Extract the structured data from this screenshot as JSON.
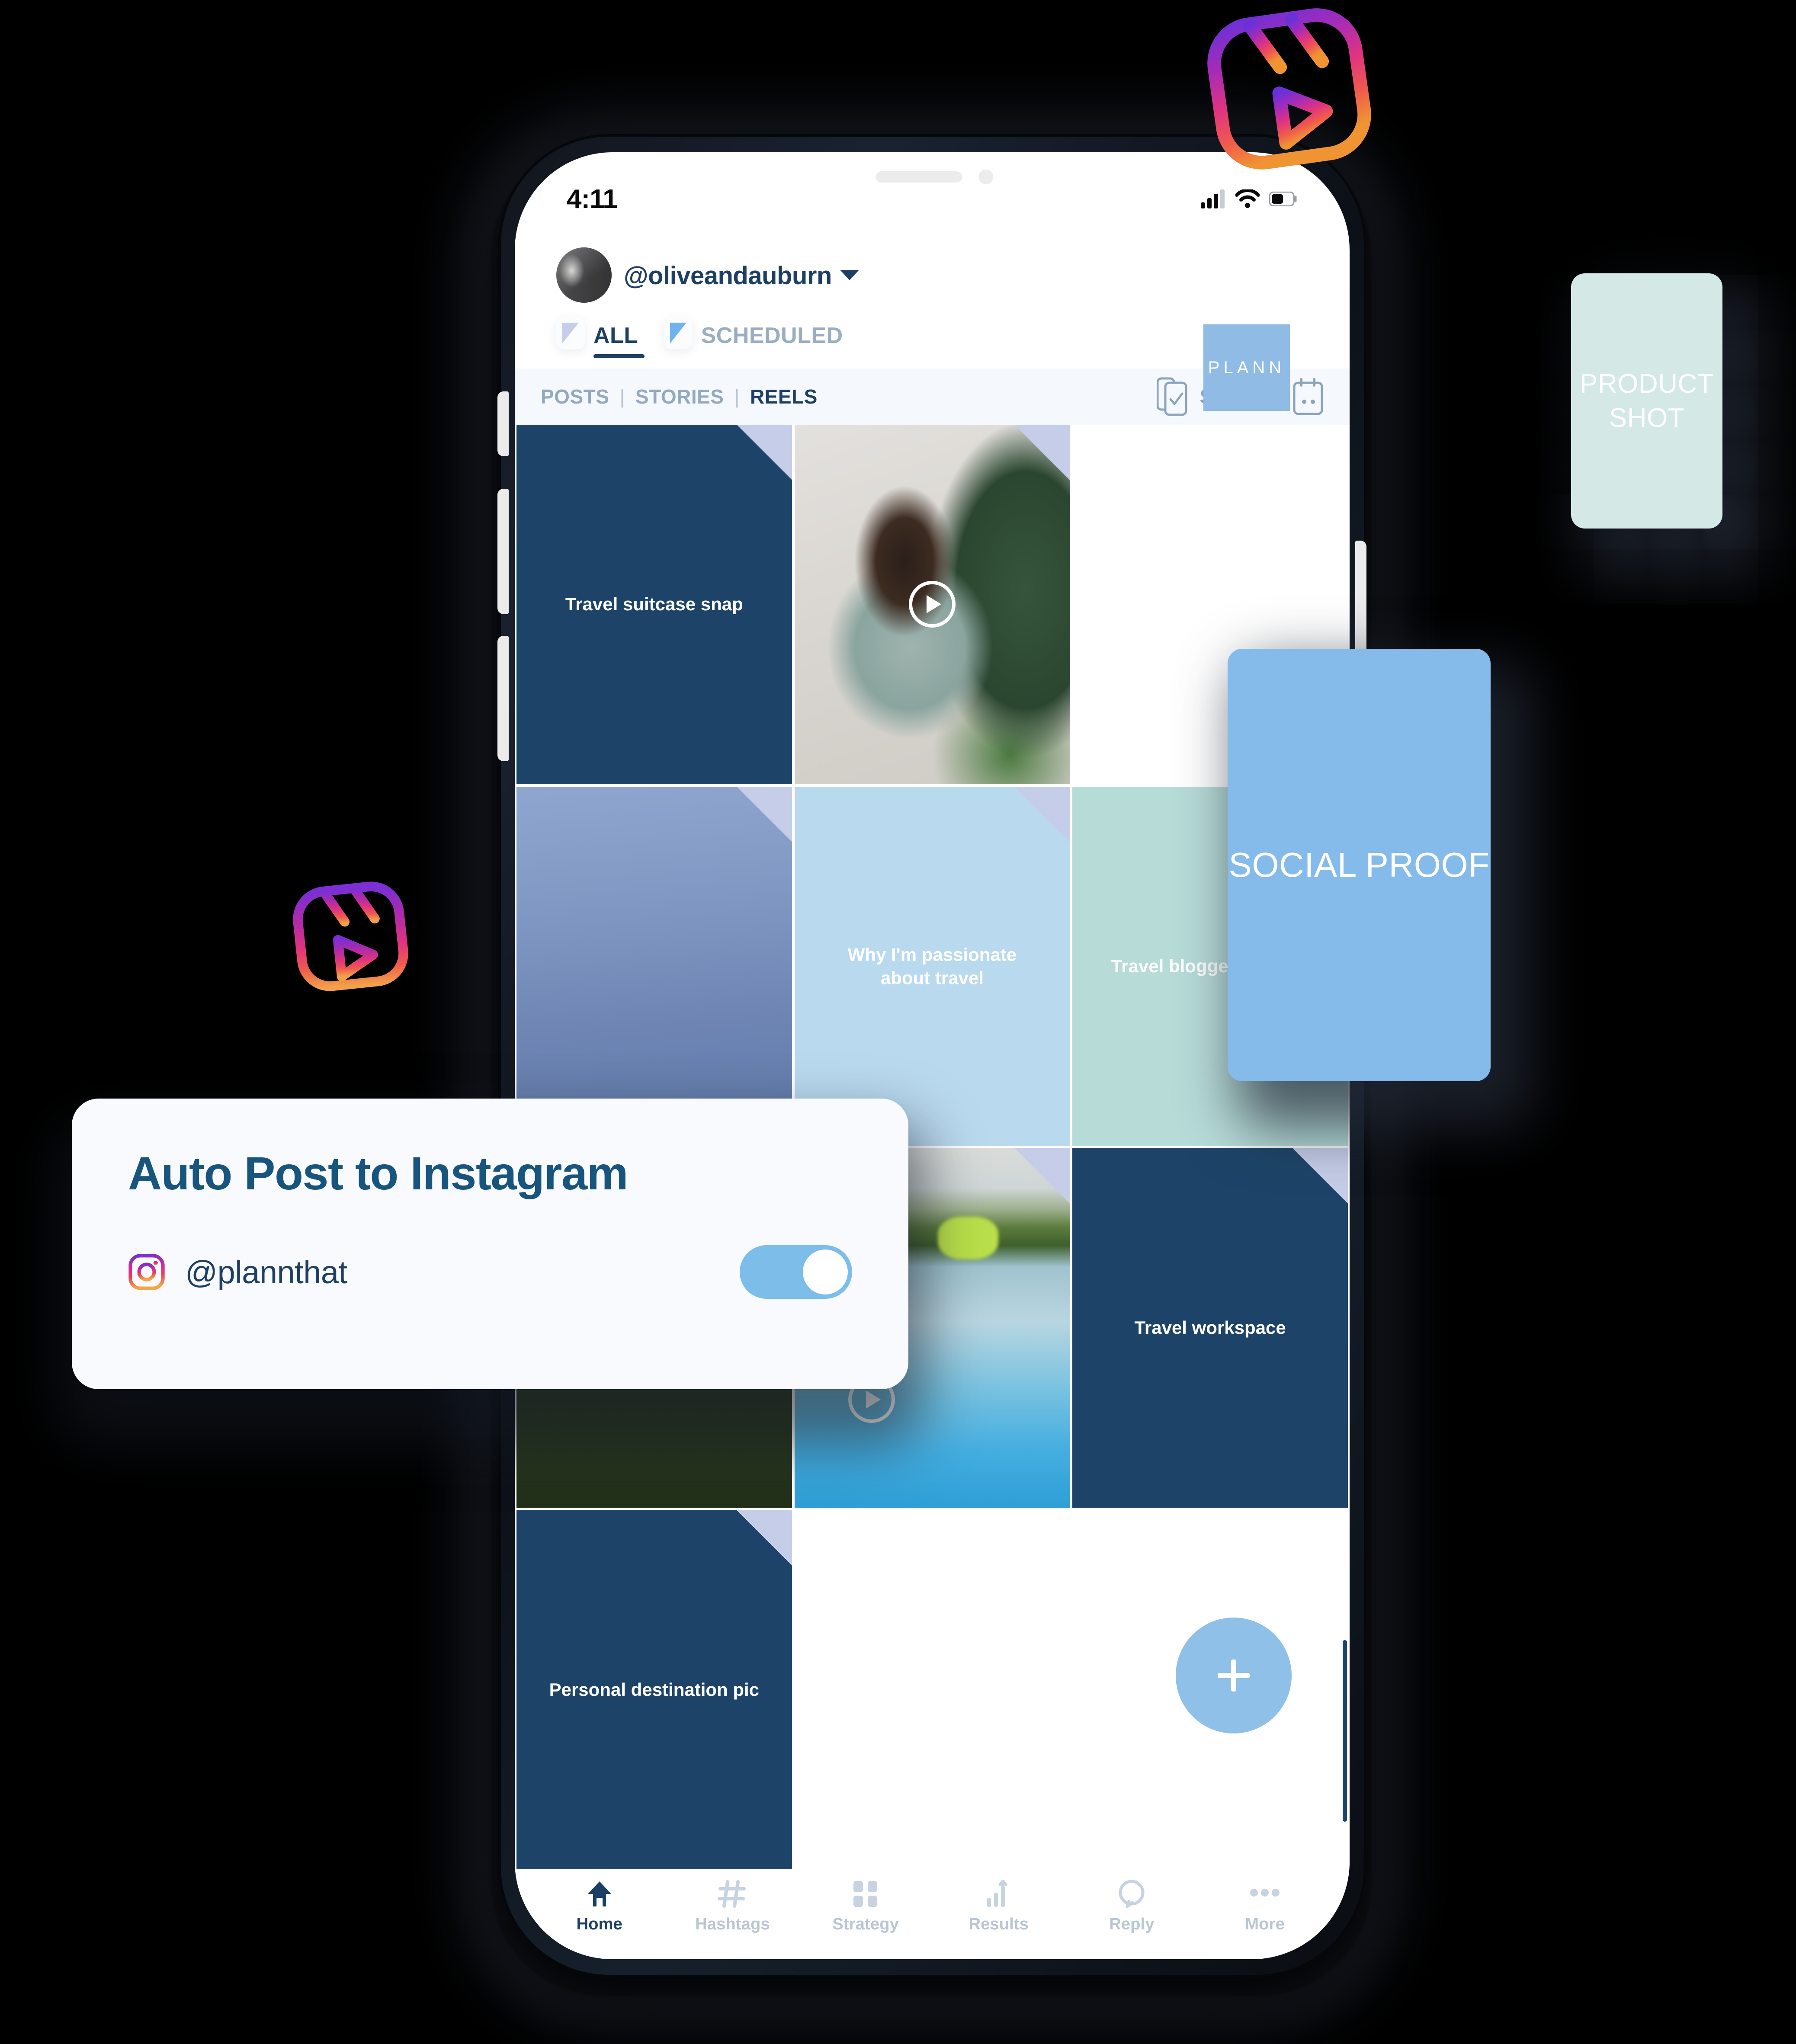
{
  "status_bar": {
    "time": "4:11",
    "icons": [
      "cellular-signal-icon",
      "wifi-icon",
      "battery-icon"
    ]
  },
  "account": {
    "handle": "@oliveandauburn",
    "watermark": "PLANN"
  },
  "tabs": [
    {
      "label": "ALL",
      "active": true
    },
    {
      "label": "SCHEDULED",
      "active": false
    }
  ],
  "filter_bar": {
    "items": [
      {
        "label": "POSTS",
        "active": false
      },
      {
        "label": "STORIES",
        "active": false
      },
      {
        "label": "REELS",
        "active": true
      }
    ],
    "separator": "|",
    "select_label": "SELECT",
    "calendar_icon": "calendar-icon",
    "select_icon": "select-phone-icon"
  },
  "grid": {
    "cells": [
      {
        "label": "Travel suitcase snap",
        "kind": "navy-label",
        "corner": true,
        "play": false
      },
      {
        "label": "",
        "kind": "photo-plant",
        "corner": true,
        "play": true
      },
      {
        "label": "",
        "kind": "empty",
        "corner": false,
        "play": false
      },
      {
        "label": "",
        "kind": "photo-sky",
        "corner": true,
        "play": false
      },
      {
        "label": "Why I'm passionate about travel",
        "kind": "lightblue-label",
        "corner": true,
        "play": false
      },
      {
        "label": "Travel blogger realities",
        "kind": "mint-label",
        "corner": false,
        "play": false
      },
      {
        "label": "",
        "kind": "photo-grass",
        "corner": false,
        "play": false
      },
      {
        "label": "",
        "kind": "photo-pool",
        "corner": true,
        "play": true
      },
      {
        "label": "Personal destination pic",
        "kind": "navy-label",
        "corner": true,
        "play": false
      },
      {
        "label": "Travel workspace",
        "kind": "navy-label",
        "corner": true,
        "play": false
      }
    ],
    "fab_label": "+"
  },
  "bottom_nav": [
    {
      "label": "Home",
      "icon": "home-icon",
      "active": true
    },
    {
      "label": "Hashtags",
      "icon": "hashtag-icon",
      "active": false
    },
    {
      "label": "Strategy",
      "icon": "grid-icon",
      "active": false
    },
    {
      "label": "Results",
      "icon": "bar-chart-icon",
      "active": false
    },
    {
      "label": "Reply",
      "icon": "comment-icon",
      "active": false
    },
    {
      "label": "More",
      "icon": "ellipsis-icon",
      "active": false
    }
  ],
  "floating": {
    "product_shot": "PRODUCT SHOT",
    "social_proof": "SOCIAL PROOF",
    "reels_badge_icon": "instagram-reels-icon"
  },
  "autopost_card": {
    "title": "Auto Post to Instagram",
    "handle": "@plannthat",
    "platform_icon": "instagram-icon",
    "toggle_state": "on"
  },
  "colors": {
    "navy": "#1d4468",
    "navy_text": "#1d3f64",
    "light_blue": "#b9d9ef",
    "mint": "#b7dcd8",
    "accent_blue": "#85bbea",
    "toggle_blue": "#7cbdea",
    "product_shot_bg": "#d4e8e6",
    "filter_bar_bg": "#f5f8fd",
    "muted": "#93a9c0"
  }
}
